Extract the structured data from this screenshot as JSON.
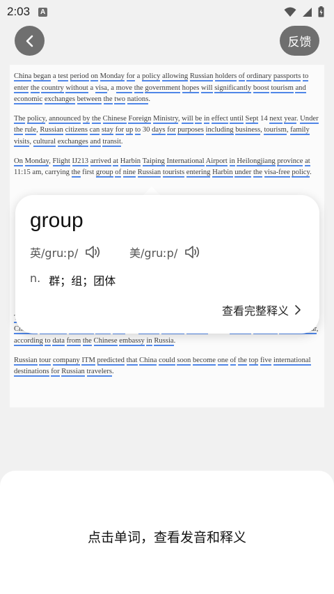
{
  "status_bar": {
    "time": "2:03",
    "app_icon_letter": "A",
    "icons": [
      "wifi-icon",
      "signal-icon",
      "battery-icon"
    ]
  },
  "header": {
    "back_icon": "chevron-left-icon",
    "feedback_label": "反馈"
  },
  "article": {
    "paragraphs": [
      "China began a test period on Monday for a policy allowing Russian holders of ordinary passports to enter the country without a visa, a move the government hopes will significantly boost tourism and economic exchanges between the two nations.",
      "The policy, announced by the Chinese Foreign Ministry, will be in effect until Sept 14 next year. Under the rule, Russian citizens can stay for up to 30 days for purposes including business, tourism, family visits, cultural exchanges and transit.",
      "On Monday, Flight IJ213 arrived at Harbin Taiping International Airport in Heilongjiang province at 11:15 am, carrying the first group of nine Russian tourists entering Harbin under the visa-free policy.",
      "The new policy came as Russia has become a key source of inbound tourists for China. Last year, the Chinese mainland received more than 1.5 million Russian visitors, a 115 percent increase year-on-year, according to data from the Chinese embassy in Russia.",
      "Russian tour company ITM predicted that China could soon become one of the top five international destinations for Russian travelers."
    ],
    "selected_word": "group"
  },
  "dictionary": {
    "word": "group",
    "uk_label": "英",
    "uk_phonetic": "/gruːp/",
    "us_label": "美",
    "us_phonetic": "/gruːp/",
    "part_of_speech": "n.",
    "definition": "群；组；团体",
    "full_definition_label": "查看完整释义"
  },
  "bottom": {
    "hint": "点击单词，查看发音和释义"
  },
  "colors": {
    "accent_underline": "#4f86e8",
    "button_gray": "#6f6f6f"
  }
}
